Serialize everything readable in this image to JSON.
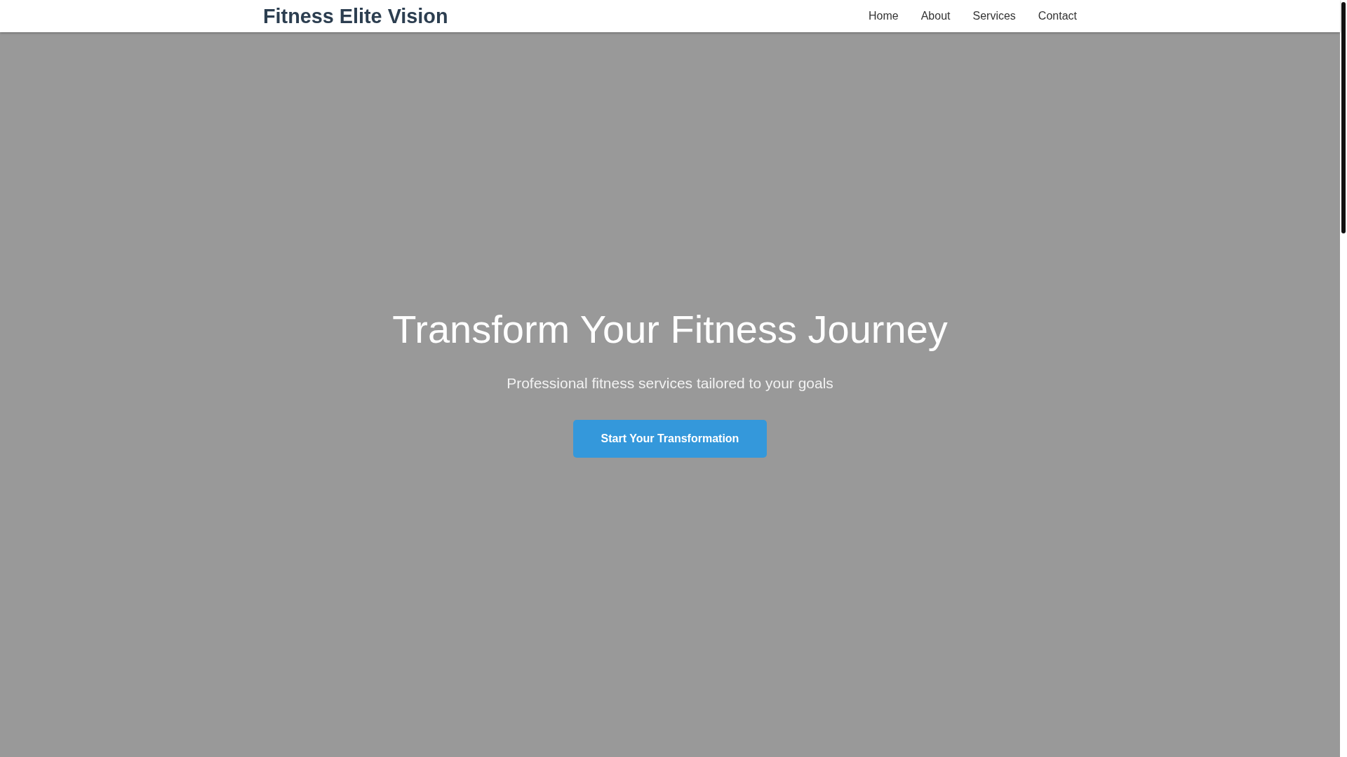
{
  "header": {
    "logo": "Fitness Elite Vision",
    "nav": [
      "Home",
      "About",
      "Services",
      "Contact"
    ]
  },
  "hero": {
    "title": "Transform Your Fitness Journey",
    "subtitle": "Professional fitness services tailored to your goals",
    "cta": "Start Your Transformation"
  }
}
